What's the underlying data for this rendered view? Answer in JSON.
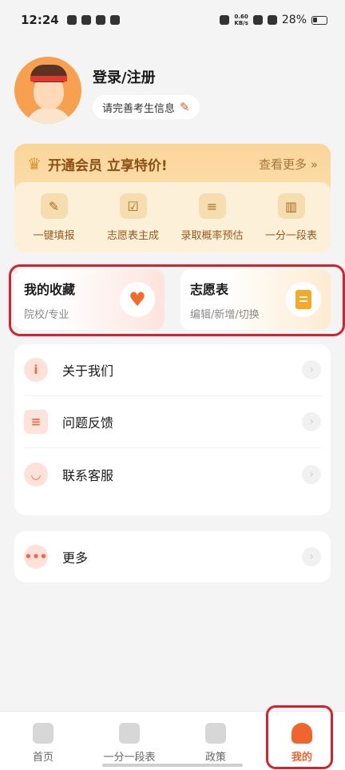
{
  "status_bar": {
    "time": "12:24",
    "net_speed_value": "0.60",
    "net_speed_unit": "KB/s",
    "battery": "28%"
  },
  "profile": {
    "login_label": "登录/注册",
    "complete_info_label": "请完善考生信息"
  },
  "vip": {
    "title": "开通会员 立享特价!",
    "more_label": "查看更多 »",
    "features": [
      {
        "label": "一键填报",
        "icon": "edit-icon"
      },
      {
        "label": "志愿表主成",
        "icon": "checklist-icon"
      },
      {
        "label": "录取概率预估",
        "icon": "stack-icon"
      },
      {
        "label": "一分一段表",
        "icon": "bar-chart-icon"
      }
    ]
  },
  "quick_cards": {
    "favorites": {
      "title": "我的收藏",
      "subtitle": "院校/专业",
      "icon": "heart-icon"
    },
    "volunteer_form": {
      "title": "志愿表",
      "subtitle": "编辑/新增/切换",
      "icon": "document-icon"
    }
  },
  "menu": {
    "items": [
      {
        "label": "关于我们",
        "icon": "info-icon"
      },
      {
        "label": "问题反馈",
        "icon": "feedback-icon"
      },
      {
        "label": "联系客服",
        "icon": "headset-icon"
      }
    ],
    "more_label": "更多"
  },
  "tabbar": {
    "tabs": [
      {
        "label": "首页",
        "icon": "home-icon"
      },
      {
        "label": "一分一段表",
        "icon": "clipboard-icon"
      },
      {
        "label": "政策",
        "icon": "badge-icon"
      },
      {
        "label": "我的",
        "icon": "person-icon"
      }
    ],
    "active": "我的"
  },
  "colors": {
    "accent": "#f0642d",
    "vip_text": "#8a4f12",
    "highlight": "#d3232d"
  }
}
